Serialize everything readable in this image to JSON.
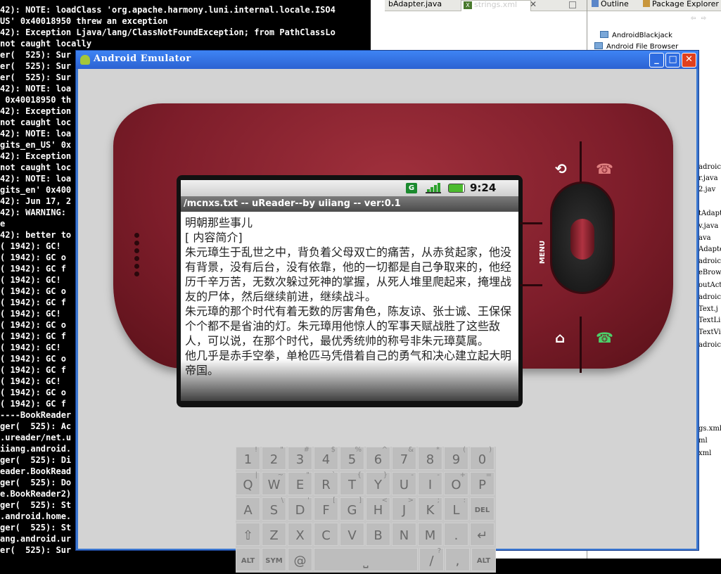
{
  "console": {
    "lines": [
      "42): NOTE: loadClass 'org.apache.harmony.luni.internal.locale.ISO4",
      "US' 0x40018950 threw an exception",
      "42): Exception Ljava/lang/ClassNotFoundException; from PathClassLo",
      "not caught locally",
      "er(  525): Sur",
      "er(  525): Sur",
      "er(  525): Sur",
      "42): NOTE: loa",
      " 0x40018950 th",
      "42): Exception",
      "not caught loc",
      "42): NOTE: loa",
      "gits_en_US' 0x",
      "42): Exception",
      "not caught loc",
      "42): NOTE: loa",
      "gits_en' 0x400",
      "42): Jun 17, 2",
      "42): WARNING: ",
      "e",
      "42): better to",
      "( 1942): GC!",
      "( 1942): GC o",
      "( 1942): GC f",
      "( 1942): GC!",
      "( 1942): GC o",
      "( 1942): GC f",
      "( 1942): GC!",
      "( 1942): GC o",
      "( 1942): GC f",
      "( 1942): GC!",
      "( 1942): GC o",
      "( 1942): GC f",
      "( 1942): GC!",
      "( 1942): GC o",
      "( 1942): GC f",
      "----BookReader",
      "ger(  525): Ac",
      ".ureader/net.u",
      "iiang.android.",
      "ger(  525): Di",
      "eader.BookRead",
      "ger(  525): Do",
      "e.BookReader2)",
      "ger(  525): St",
      ".android.home.",
      "ger(  525): St",
      "ang.android.ur",
      "er(  525): Sur"
    ]
  },
  "editor": {
    "tab1": "bAdapter.java",
    "tab2": "strings.xml",
    "close": "✕"
  },
  "outline": {
    "tab1": "Outline",
    "tab2": "Package Explorer",
    "tree": [
      "AndroidBlackjack",
      "Android File Browser"
    ],
    "right_snippets": [
      "adroic",
      "r.java",
      "2.jav",
      "tAdapt",
      "v.java",
      "ava",
      "Adapte",
      "adroic",
      "eBrow",
      "outAct",
      "adroic",
      "Text.j",
      "TextLi",
      "TextVi",
      "adroic",
      "gs.xml",
      "ml",
      "xml"
    ]
  },
  "emulator": {
    "title": "Android Emulator",
    "status": {
      "carrier_icon": "G",
      "time": "9:24 AM"
    },
    "app_title": "/mcnxs.txt -- uReader--by uiiang -- ver:0.1",
    "paragraphs": [
      "明朝那些事儿",
      "[ 内容简介]",
      "朱元璋生于乱世之中，背负着父母双亡的痛苦，从赤贫起家，他没有背景，没有后台，没有依靠，他的一切都是自己争取来的，他经历千辛万苦，无数次躲过死神的掌握，从死人堆里爬起来，掩埋战友的尸体，然后继续前进，继续战斗。",
      "朱元璋的那个时代有着无数的厉害角色，陈友谅、张士诚、王保保个个都不是省油的灯。朱元璋用他惊人的军事天赋战胜了这些敌人，可以说，在那个时代，最优秀统帅的称号非朱元璋莫属。",
      "他几乎是赤手空拳，单枪匹马凭借着自己的勇气和决心建立起大明帝国。"
    ],
    "menu_label": "MENU",
    "buttons": {
      "back": "⟲",
      "call_end": "☎",
      "home": "⌂",
      "call": "☎"
    }
  },
  "keyboard": {
    "row1": [
      [
        "1",
        "!"
      ],
      [
        "2",
        "\""
      ],
      [
        "3",
        "#"
      ],
      [
        "4",
        "$"
      ],
      [
        "5",
        "%"
      ],
      [
        "6",
        "^"
      ],
      [
        "7",
        "&"
      ],
      [
        "8",
        "*"
      ],
      [
        "9",
        "("
      ],
      [
        "0",
        ")"
      ]
    ],
    "row2": [
      [
        "Q",
        "|"
      ],
      [
        "W",
        "~"
      ],
      [
        "E",
        "\""
      ],
      [
        "R",
        "`"
      ],
      [
        "T",
        "{"
      ],
      [
        "Y",
        "}"
      ],
      [
        "U",
        "-"
      ],
      [
        "I",
        "-"
      ],
      [
        "O",
        "+"
      ],
      [
        "P",
        "="
      ]
    ],
    "row3": [
      [
        "A",
        ""
      ],
      [
        "S",
        "\\"
      ],
      [
        "D",
        "'"
      ],
      [
        "F",
        "["
      ],
      [
        "G",
        "]"
      ],
      [
        "H",
        "<"
      ],
      [
        "J",
        ">"
      ],
      [
        "K",
        ";"
      ],
      [
        "L",
        ":"
      ],
      [
        "DEL",
        ""
      ]
    ],
    "row4": [
      [
        "⇧",
        ""
      ],
      [
        "Z",
        ""
      ],
      [
        "X",
        ""
      ],
      [
        "C",
        ""
      ],
      [
        "V",
        ""
      ],
      [
        "B",
        ""
      ],
      [
        "N",
        ""
      ],
      [
        "M",
        ""
      ],
      [
        ".",
        ""
      ],
      [
        "↵",
        ""
      ]
    ],
    "row5": [
      [
        "ALT",
        ""
      ],
      [
        "SYM",
        ""
      ],
      [
        "@",
        ""
      ],
      [
        "⎵",
        ""
      ],
      [
        "/",
        "?"
      ],
      [
        ",",
        ""
      ],
      [
        "ALT",
        ""
      ]
    ]
  }
}
